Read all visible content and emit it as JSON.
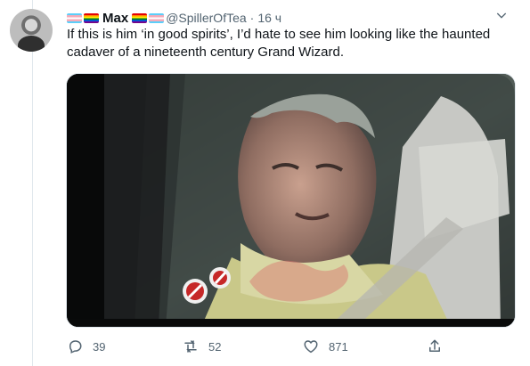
{
  "tweet": {
    "author_name": "Max",
    "handle": "@SpillerOfTea",
    "separator": "·",
    "time": "16 ч",
    "text": "If this is him ‘in good spirits’, I’d hate to see him looking like the haunted cadaver of a nineteenth century Grand Wizard."
  },
  "actions": {
    "reply_count": "39",
    "retweet_count": "52",
    "like_count": "871"
  },
  "colors": {
    "muted": "#536471",
    "line": "#e1e8ed",
    "text": "#0f1419"
  }
}
